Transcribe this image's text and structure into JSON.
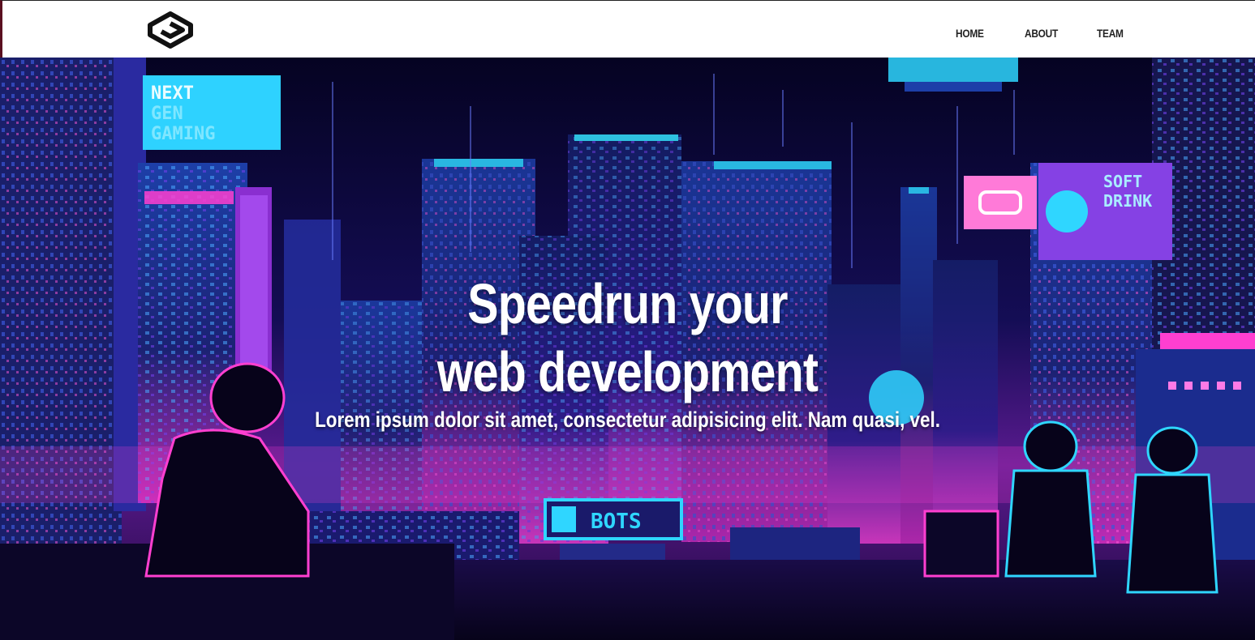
{
  "nav": {
    "logo_icon": "stacked-g-logo-icon",
    "links": [
      "HOME",
      "ABOUT",
      "TEAM"
    ]
  },
  "hero": {
    "headline_line1": "Speedrun your",
    "headline_line2": "web development",
    "subheading": "Lorem ipsum dolor sit amet, consectetur adipisicing elit. Nam quasi, vel.",
    "background": "pixel-art-cyberpunk-city",
    "signs": {
      "next": "NEXT",
      "gen": "GEN",
      "gaming": "GAMING",
      "bots": "BOTS",
      "soft": "SOFT",
      "drink": "DRINK"
    }
  },
  "colors": {
    "navbar_bg": "#ffffff",
    "nav_text": "#222222",
    "sky": "#0a0630",
    "neon_blue": "#2fd6ff",
    "neon_pink": "#ff3fd0",
    "building_blue": "#1c2a8a",
    "hero_text": "#ffffff"
  }
}
